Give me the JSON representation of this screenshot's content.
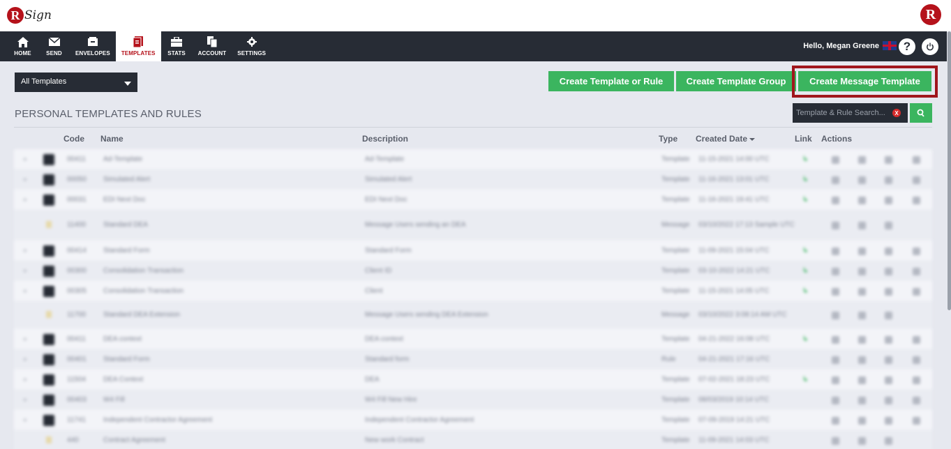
{
  "app": {
    "logo_letter": "R",
    "logo_word": "Sign",
    "brand_color": "#b5121b",
    "accent_green": "#3bb55f"
  },
  "nav": {
    "items": [
      {
        "label": "HOME",
        "icon": "home-icon",
        "active": false
      },
      {
        "label": "SEND",
        "icon": "envelope-icon",
        "active": false
      },
      {
        "label": "ENVELOPES",
        "icon": "inbox-icon",
        "active": false
      },
      {
        "label": "TEMPLATES",
        "icon": "template-icon",
        "active": true
      },
      {
        "label": "STATS",
        "icon": "briefcase-icon",
        "active": false
      },
      {
        "label": "ACCOUNT",
        "icon": "copy-icon",
        "active": false
      },
      {
        "label": "SETTINGS",
        "icon": "gear-icon",
        "active": false
      }
    ],
    "greeting": "Hello, Megan Greene",
    "help_label": "?"
  },
  "toolbar": {
    "filter_selected": "All Templates",
    "create_template_rule": "Create Template or Rule",
    "create_template_group": "Create Template Group",
    "create_message_template": "Create Message Template"
  },
  "section": {
    "title": "PERSONAL TEMPLATES AND RULES",
    "search_placeholder": "Template & Rule Search...",
    "search_clear": "X"
  },
  "table": {
    "columns": {
      "code": "Code",
      "name": "Name",
      "description": "Description",
      "type": "Type",
      "created_date": "Created Date",
      "link": "Link",
      "actions": "Actions"
    },
    "rows": [
      {
        "code": "00411",
        "name": "Ad-Template",
        "description": "Ad-Template",
        "type": "Template",
        "date": "11-15-2021 14:00 UTC",
        "kind": "template",
        "link": true
      },
      {
        "code": "00050",
        "name": "Simulated Alert",
        "description": "Simulated Alert",
        "type": "Template",
        "date": "11-16-2021 13:01 UTC",
        "kind": "template",
        "link": true
      },
      {
        "code": "00031",
        "name": "EDI Next Doc",
        "description": "EDI Next Doc",
        "type": "Template",
        "date": "11-16-2021 19:41 UTC",
        "kind": "template",
        "link": true
      },
      {
        "code": "11400",
        "name": "Standard DEA",
        "description": "Message Users sending an DEA",
        "type": "Message",
        "date": "03/10/2022 17:13 Sample UTC",
        "kind": "message",
        "link": false
      },
      {
        "code": "00414",
        "name": "Standard Form",
        "description": "Standard Form",
        "type": "Template",
        "date": "11-09-2021 15:04 UTC",
        "kind": "template",
        "link": true
      },
      {
        "code": "00300",
        "name": "Consolidation Transaction",
        "description": "Client ID",
        "type": "Template",
        "date": "03-10-2022 14:21 UTC",
        "kind": "template",
        "link": true
      },
      {
        "code": "00305",
        "name": "Consolidation Transaction",
        "description": "Client",
        "type": "Template",
        "date": "11-15-2021 14:05 UTC",
        "kind": "template",
        "link": true
      },
      {
        "code": "11700",
        "name": "Standard DEA Extension",
        "description": "Message Users sending DEA Extension",
        "type": "Message",
        "date": "03/10/2022 3:08:14 AM UTC",
        "kind": "message",
        "link": false
      },
      {
        "code": "00411",
        "name": "DEA context",
        "description": "DEA context",
        "type": "Template",
        "date": "04-21-2022 16:08 UTC",
        "kind": "template",
        "link": true
      },
      {
        "code": "00401",
        "name": "Standard Form",
        "description": "Standard form",
        "type": "Rule",
        "date": "04-21-2021 17:16 UTC",
        "kind": "template",
        "link": false
      },
      {
        "code": "11504",
        "name": "DEA Context",
        "description": "DEA",
        "type": "Template",
        "date": "07-02-2021 18:23 UTC",
        "kind": "template",
        "link": true
      },
      {
        "code": "00403",
        "name": "W4 Fill",
        "description": "W4 Fill New Hire",
        "type": "Template",
        "date": "08/03/2019 10:14 UTC",
        "kind": "template",
        "link": false
      },
      {
        "code": "11741",
        "name": "Independent Contractor Agreement",
        "description": "Independent Contractor Agreement",
        "type": "Template",
        "date": "07-09-2019 14:21 UTC",
        "kind": "template",
        "link": false
      },
      {
        "code": "440",
        "name": "Contract Agreement",
        "description": "New work Contract",
        "type": "Template",
        "date": "11-09-2021 14:03 UTC",
        "kind": "message",
        "link": false
      }
    ]
  }
}
